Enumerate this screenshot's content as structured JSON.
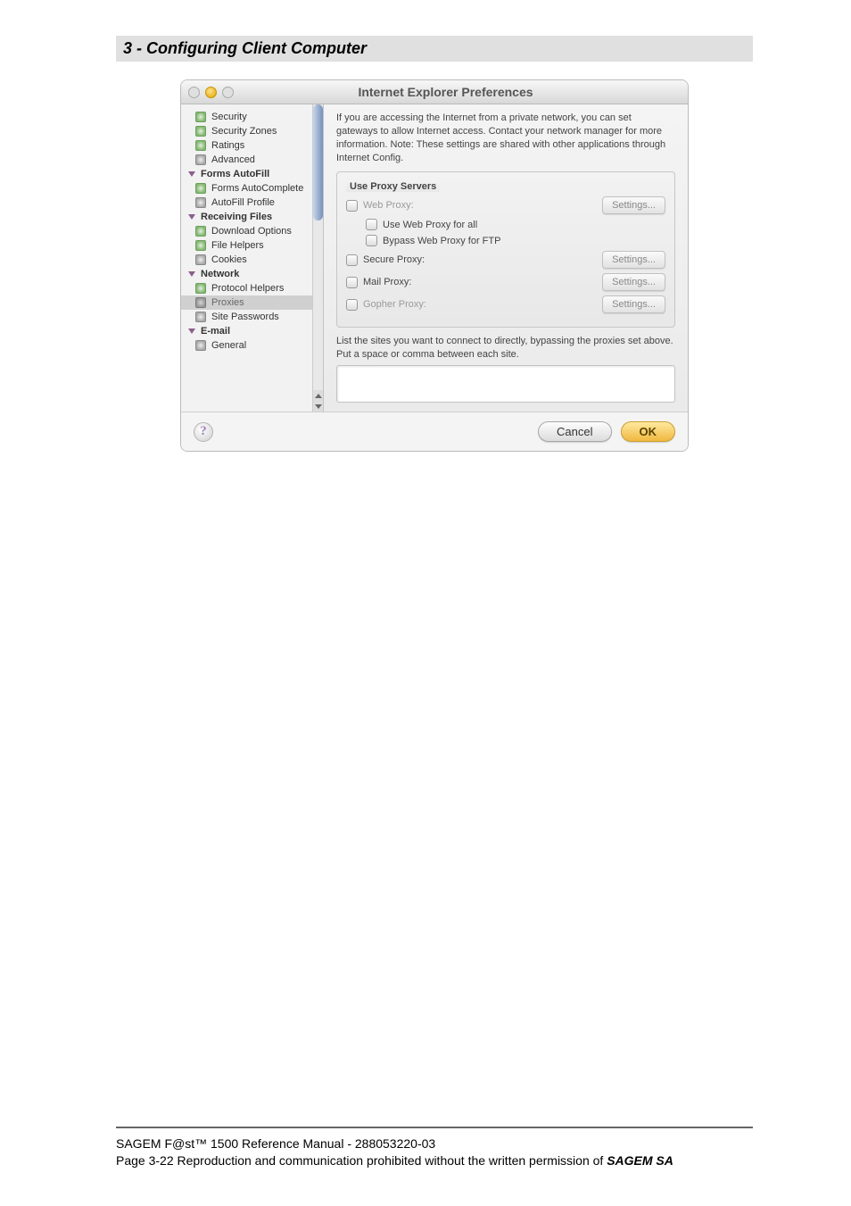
{
  "page": {
    "heading": "3 - Configuring Client Computer"
  },
  "window": {
    "title": "Internet Explorer Preferences"
  },
  "sidebar": {
    "items": [
      {
        "kind": "item",
        "label": "Security",
        "icon": "ie"
      },
      {
        "kind": "item",
        "label": "Security Zones",
        "icon": "ie"
      },
      {
        "kind": "item",
        "label": "Ratings",
        "icon": "ie"
      },
      {
        "kind": "item",
        "label": "Advanced",
        "icon": "adv"
      },
      {
        "kind": "cat",
        "label": "Forms AutoFill"
      },
      {
        "kind": "item",
        "label": "Forms AutoComplete",
        "icon": "ie"
      },
      {
        "kind": "item",
        "label": "AutoFill Profile",
        "icon": "adv"
      },
      {
        "kind": "cat",
        "label": "Receiving Files"
      },
      {
        "kind": "item",
        "label": "Download Options",
        "icon": "ie"
      },
      {
        "kind": "item",
        "label": "File Helpers",
        "icon": "ie"
      },
      {
        "kind": "item",
        "label": "Cookies",
        "icon": "adv"
      },
      {
        "kind": "cat",
        "label": "Network"
      },
      {
        "kind": "item",
        "label": "Protocol Helpers",
        "icon": "ie"
      },
      {
        "kind": "item",
        "label": "Proxies",
        "icon": "adv",
        "selected": true
      },
      {
        "kind": "item",
        "label": "Site Passwords",
        "icon": "adv"
      },
      {
        "kind": "cat",
        "label": "E-mail"
      },
      {
        "kind": "item",
        "label": "General",
        "icon": "adv"
      }
    ]
  },
  "content": {
    "intro": "If you are accessing the Internet from a private network, you can set gateways to allow Internet access. Contact your network manager for more information. Note: These settings are shared with other applications through Internet Config.",
    "fieldset_legend": "Use Proxy Servers",
    "rows": {
      "web_proxy": {
        "label": "Web Proxy:",
        "btn": "Settings...",
        "disabled": true
      },
      "use_for_all": {
        "label": "Use Web Proxy for all"
      },
      "bypass_ftp": {
        "label": "Bypass Web Proxy for FTP"
      },
      "secure": {
        "label": "Secure Proxy:",
        "btn": "Settings..."
      },
      "mail": {
        "label": "Mail Proxy:",
        "btn": "Settings..."
      },
      "gopher": {
        "label": "Gopher Proxy:",
        "btn": "Settings...",
        "disabled": true
      }
    },
    "bypass_note": "List the sites you want to connect to directly,  bypassing the proxies set above.  Put a space or comma between each site."
  },
  "footer_btns": {
    "help": "?",
    "cancel": "Cancel",
    "ok": "OK"
  },
  "page_footer": {
    "line1": "SAGEM F@st™ 1500 Reference Manual - 288053220-03",
    "line2a": "Page 3-22        Reproduction and communication prohibited without the written permission of ",
    "line2b": "SAGEM SA"
  }
}
